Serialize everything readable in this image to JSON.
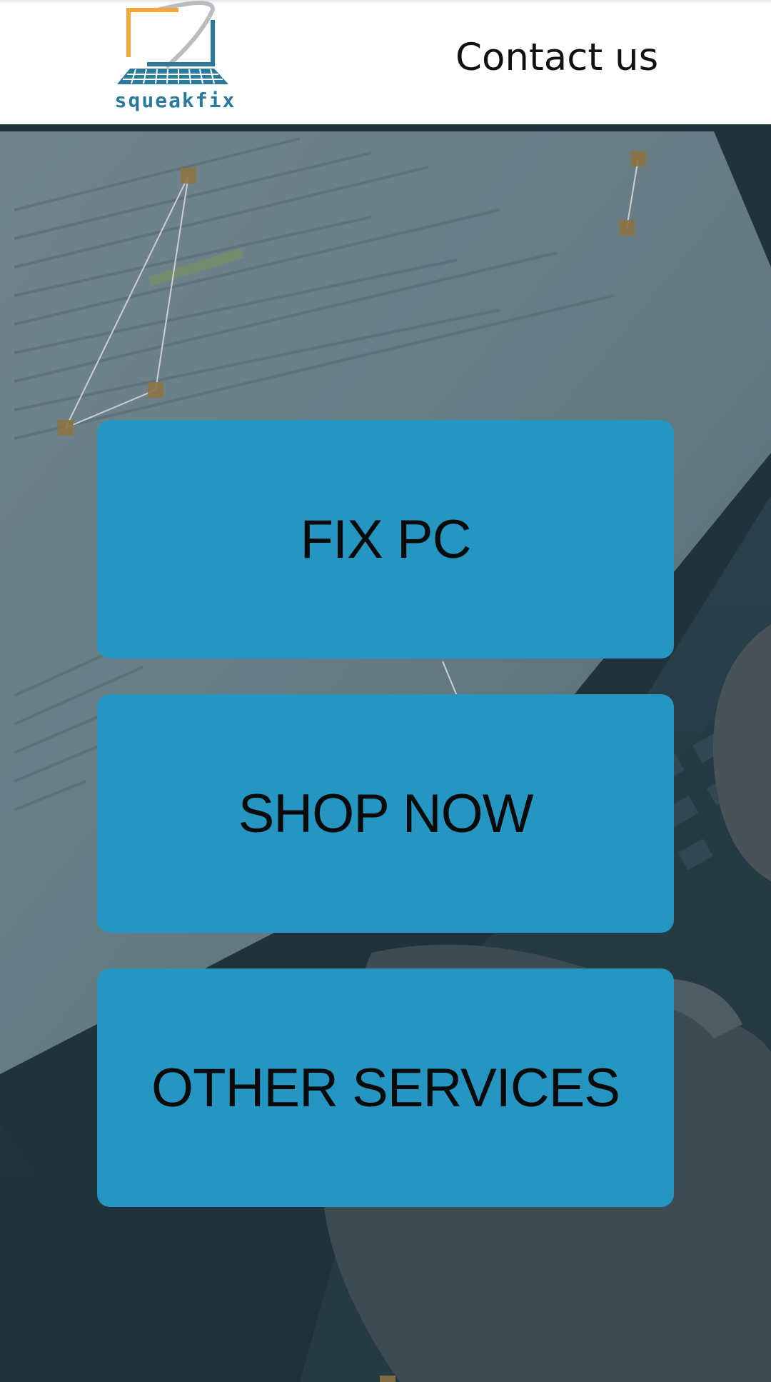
{
  "header": {
    "logo": {
      "icon": "laptop-logo-icon",
      "text": "squeakfix",
      "colors": {
        "screen_frame": "#f5a53a",
        "screen_blue": "#2b7a9b",
        "keyboard": "#2b7a9b"
      }
    },
    "contact_label": "Contact us"
  },
  "hero": {
    "background": "laptop-typing-photo",
    "overlay_color": "#2f4550",
    "buttons": [
      {
        "label": "FIX PC"
      },
      {
        "label": "SHOP NOW"
      },
      {
        "label": "OTHER SERVICES"
      }
    ],
    "button_color": "#2596c1"
  }
}
